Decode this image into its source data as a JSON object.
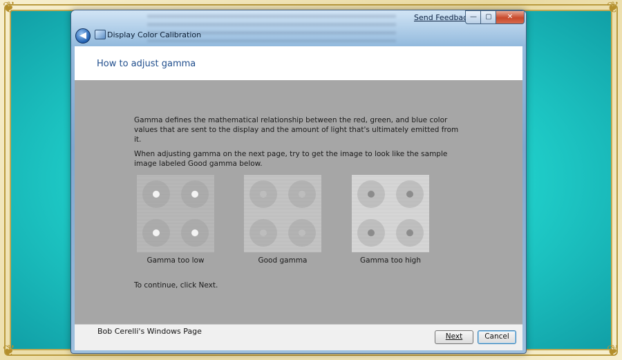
{
  "window": {
    "app_title": "Display Color Calibration",
    "feedback_link": "Send Feedback",
    "controls": {
      "minimize": "—",
      "maximize": "▢",
      "close": "✕"
    }
  },
  "header": {
    "title": "How to adjust gamma"
  },
  "content": {
    "paragraph1": "Gamma defines the mathematical relationship between the red, green, and blue color values that are sent to the display and the amount of light that's ultimately emitted from it.",
    "paragraph2": "When adjusting gamma on the next page, try to get the image to look like the sample image labeled Good gamma below.",
    "samples": [
      {
        "label": "Gamma too low",
        "background": "#bdbdbd",
        "dot_color": "#f4f4f4"
      },
      {
        "label": "Good gamma",
        "background": "#c9c9c9",
        "dot_color": "#bdbdbd"
      },
      {
        "label": "Gamma too high",
        "background": "#dcdcdc",
        "dot_color": "#8c8c8c"
      }
    ],
    "paragraph3": "To continue, click Next."
  },
  "footer": {
    "brand": "Bob Cerelli's Windows Page",
    "next_label": "Next",
    "cancel_label": "Cancel"
  },
  "colors": {
    "desktop": "#21d3cd",
    "content_bg": "#a6a6a6",
    "header_title": "#1f4d8c"
  },
  "icons": {
    "back": "back-arrow-icon",
    "app": "display-icon"
  }
}
